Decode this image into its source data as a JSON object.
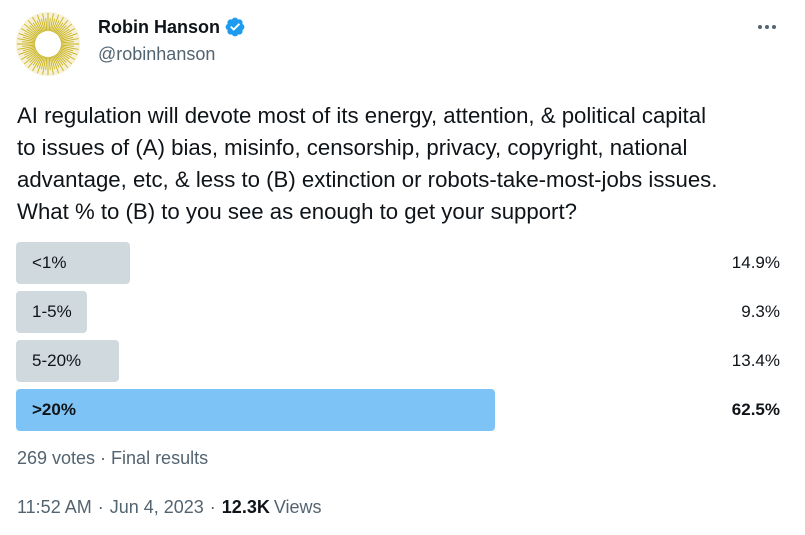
{
  "author": {
    "display_name": "Robin Hanson",
    "handle": "@robinhanson",
    "verified": true
  },
  "tweet": {
    "text": "AI regulation will devote most of its energy, attention, & political capital\nto issues of (A) bias, misinfo, censorship, privacy, copyright, national\nadvantage, etc, & less to (B) extinction or robots-take-most-jobs issues.\nWhat % to (B) to you see as enough to get your support?"
  },
  "poll": {
    "options": [
      {
        "label": "<1%",
        "percent_text": "14.9%",
        "percent": 14.9,
        "winner": false
      },
      {
        "label": "1-5%",
        "percent_text": "9.3%",
        "percent": 9.3,
        "winner": false
      },
      {
        "label": "5-20%",
        "percent_text": "13.4%",
        "percent": 13.4,
        "winner": false
      },
      {
        "label": ">20%",
        "percent_text": "62.5%",
        "percent": 62.5,
        "winner": true
      }
    ],
    "summary": "269 votes · Final results"
  },
  "meta": {
    "time": "11:52 AM",
    "date": "Jun 4, 2023",
    "views_count": "12.3K",
    "views_label": "Views",
    "separator": "·"
  },
  "colors": {
    "bar": "#cfd9de",
    "winner_bar": "#7ec3f5",
    "verified": "#1d9bf0",
    "secondary_text": "#536471"
  },
  "icons": {
    "avatar": "sun-starburst-avatar",
    "verified": "verified-badge-icon",
    "more": "more-options-icon"
  }
}
